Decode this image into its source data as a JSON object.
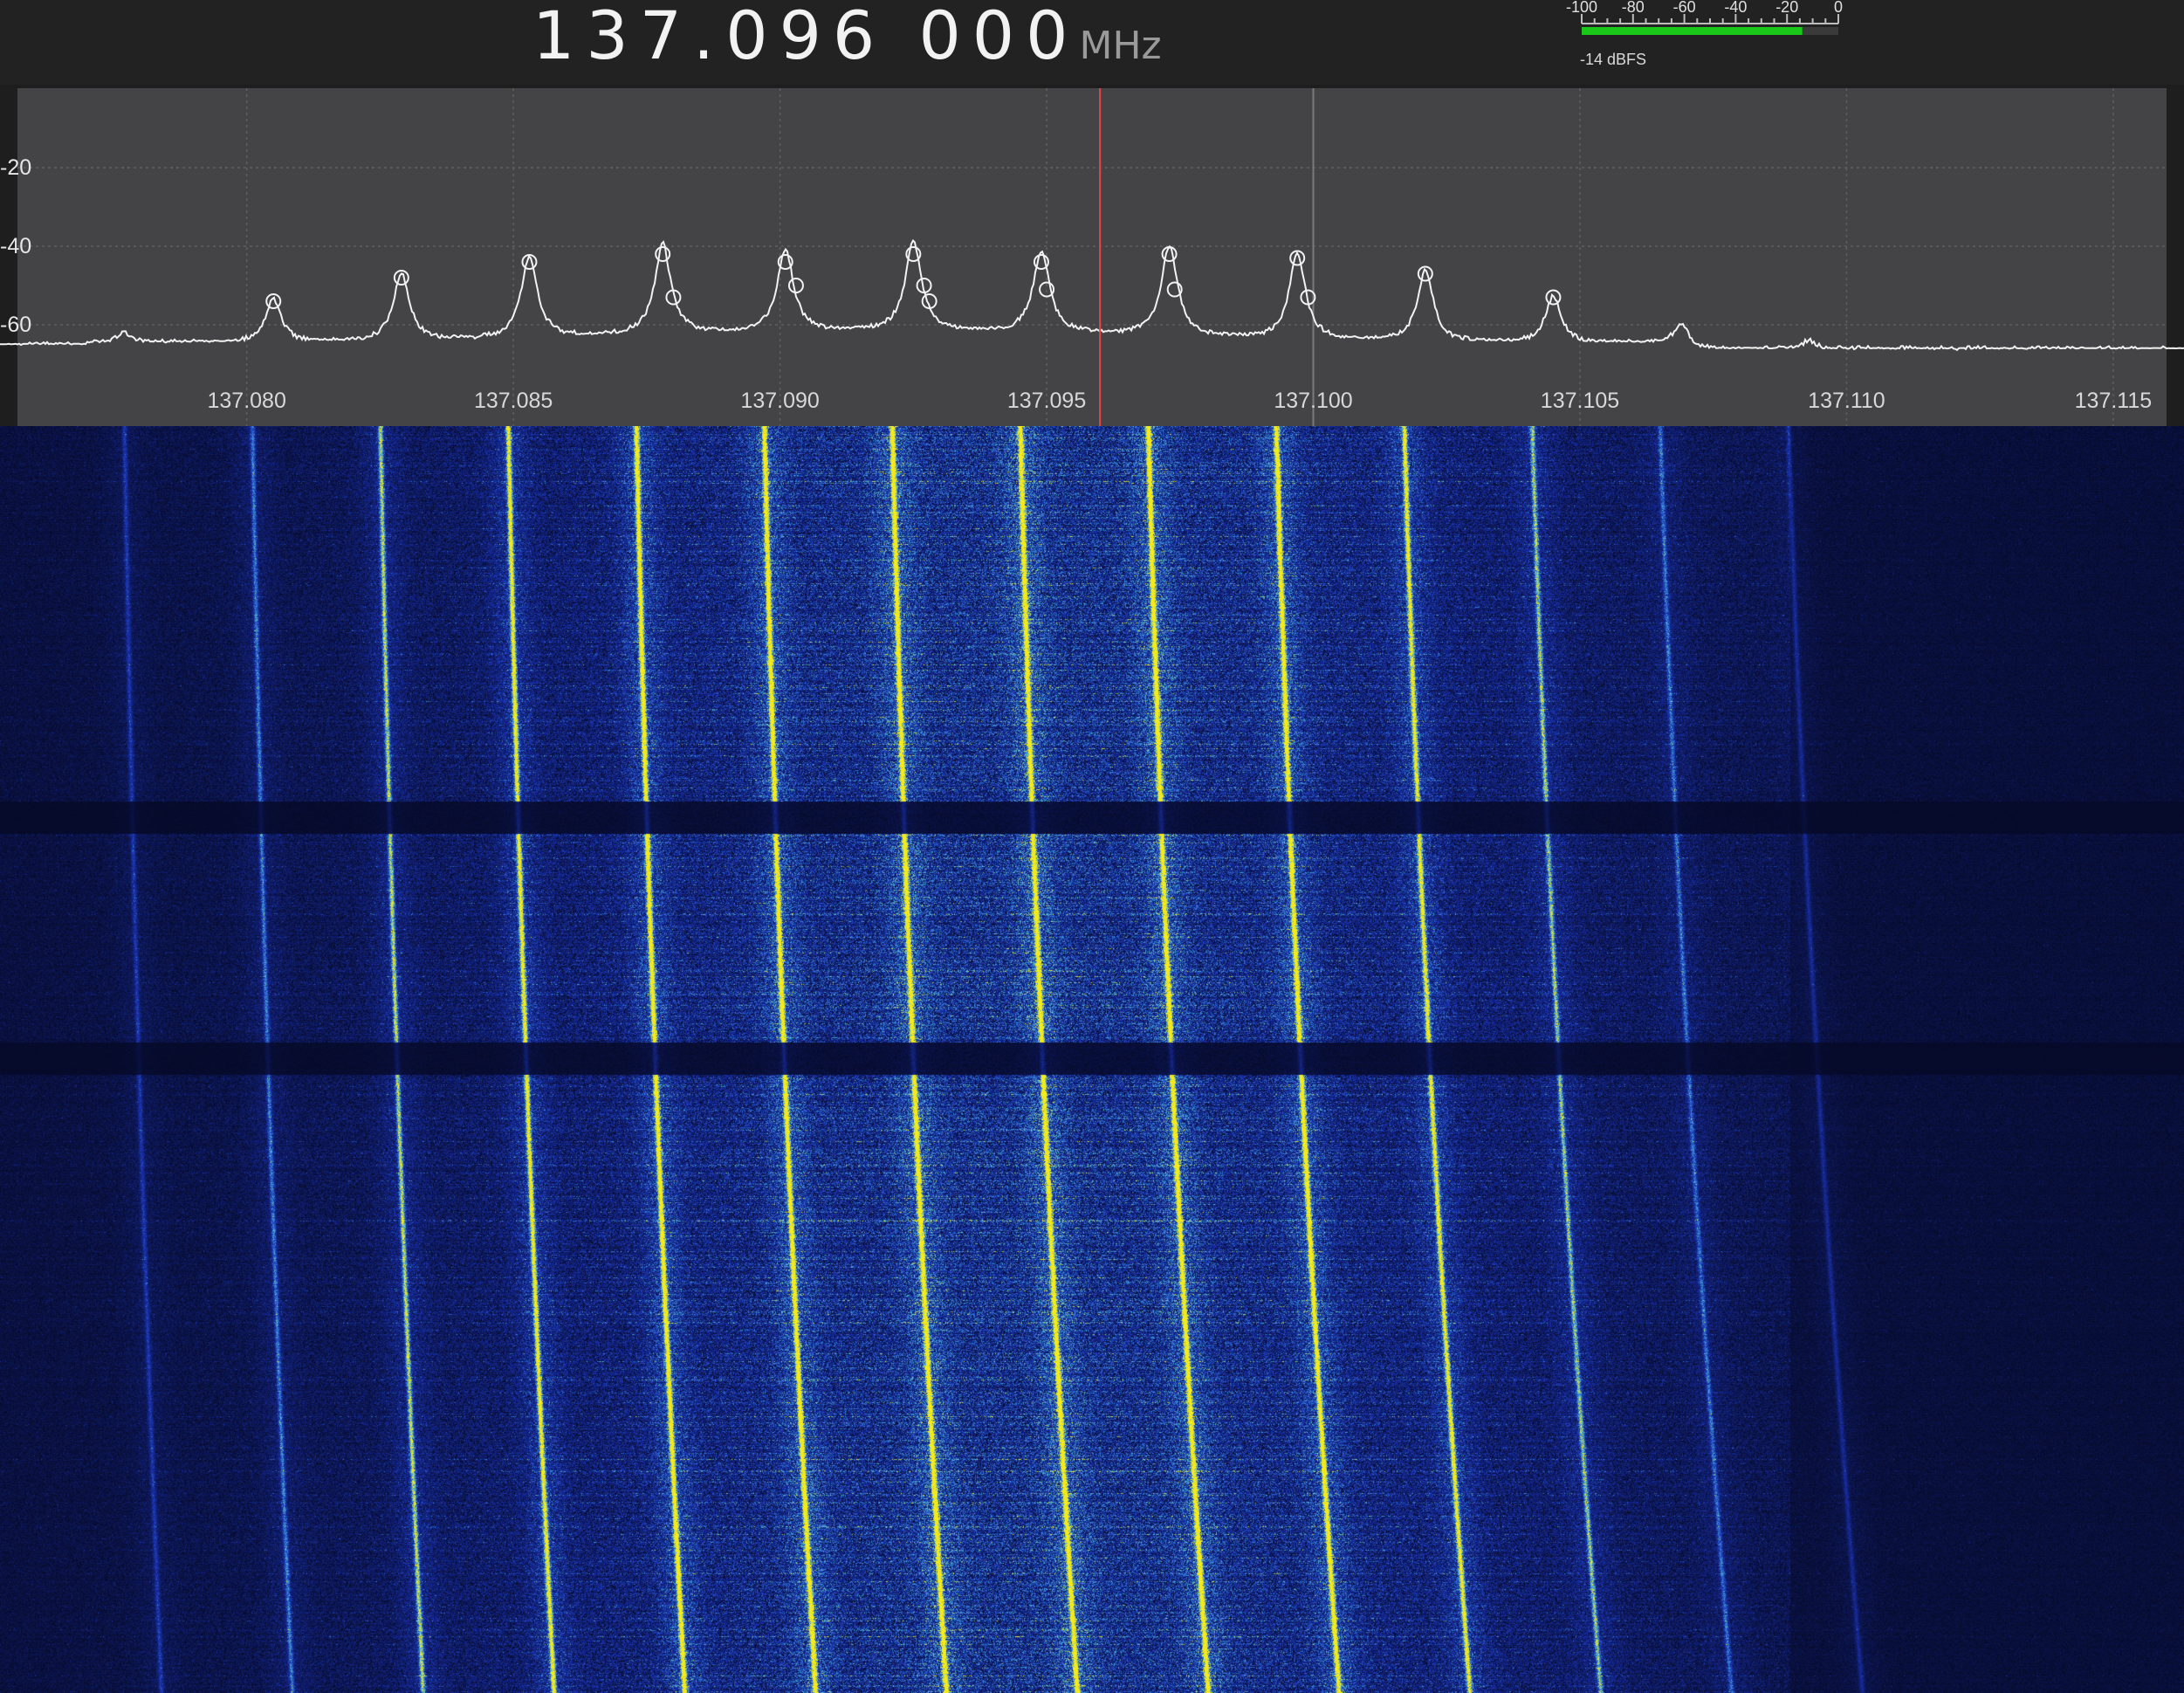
{
  "frequency": {
    "display": "137.096 000",
    "unit": "MHz",
    "value_mhz": 137.096
  },
  "level_meter": {
    "ticks": [
      "-100",
      "-80",
      "-60",
      "-40",
      "-20",
      "0"
    ],
    "readout": "-14 dBFS",
    "level_dbfs": -14,
    "bar_color": "#19c819"
  },
  "spectrum": {
    "db_labels": [
      "-20",
      "-40",
      "-60"
    ],
    "db_ticks": [
      -20,
      -40,
      -60
    ],
    "freq_labels": [
      "137.080",
      "137.085",
      "137.090",
      "137.095",
      "137.100",
      "137.105",
      "137.110",
      "137.115"
    ],
    "freq_ticks_mhz": [
      137.08,
      137.085,
      137.09,
      137.095,
      137.1,
      137.105,
      137.11,
      137.115
    ],
    "tuned_mhz": 137.096,
    "span_mhz": [
      137.0757,
      137.116
    ],
    "db_range": [
      0,
      -72
    ],
    "noise_floor_db": -65,
    "peaks": [
      {
        "mhz": 137.0777,
        "db": -62,
        "marked": false
      },
      {
        "mhz": 137.0805,
        "db": -54,
        "marked": true
      },
      {
        "mhz": 137.0829,
        "db": -48,
        "marked": true
      },
      {
        "mhz": 137.0853,
        "db": -44,
        "marked": true
      },
      {
        "mhz": 137.0878,
        "db": -42,
        "marked": true
      },
      {
        "mhz": 137.088,
        "db": -53,
        "marked": true
      },
      {
        "mhz": 137.0901,
        "db": -44,
        "marked": true
      },
      {
        "mhz": 137.0903,
        "db": -50,
        "marked": true
      },
      {
        "mhz": 137.0925,
        "db": -42,
        "marked": true
      },
      {
        "mhz": 137.0927,
        "db": -50,
        "marked": true
      },
      {
        "mhz": 137.0928,
        "db": -54,
        "marked": true
      },
      {
        "mhz": 137.0949,
        "db": -44,
        "marked": true
      },
      {
        "mhz": 137.095,
        "db": -51,
        "marked": true
      },
      {
        "mhz": 137.0973,
        "db": -42,
        "marked": true
      },
      {
        "mhz": 137.0974,
        "db": -51,
        "marked": true
      },
      {
        "mhz": 137.0997,
        "db": -43,
        "marked": true
      },
      {
        "mhz": 137.0999,
        "db": -53,
        "marked": true
      },
      {
        "mhz": 137.1021,
        "db": -47,
        "marked": true
      },
      {
        "mhz": 137.1045,
        "db": -53,
        "marked": true
      },
      {
        "mhz": 137.1069,
        "db": -60,
        "marked": false
      },
      {
        "mhz": 137.1093,
        "db": -64,
        "marked": false
      }
    ]
  },
  "waterfall": {
    "lines_start_mhz": [
      137.0777,
      137.0801,
      137.0825,
      137.0849,
      137.0873,
      137.0897,
      137.0921,
      137.0945,
      137.0969,
      137.0993,
      137.1017,
      137.1041,
      137.1065,
      137.1089
    ],
    "drift_mhz": 0.0011,
    "strength": [
      0.3,
      0.45,
      0.7,
      0.9,
      1.0,
      1.0,
      1.0,
      1.0,
      1.0,
      1.0,
      0.85,
      0.6,
      0.4,
      0.25
    ],
    "colors": {
      "background": "#060a28",
      "noise": "#1a2fa8",
      "signal": "#f5ea1a"
    }
  }
}
